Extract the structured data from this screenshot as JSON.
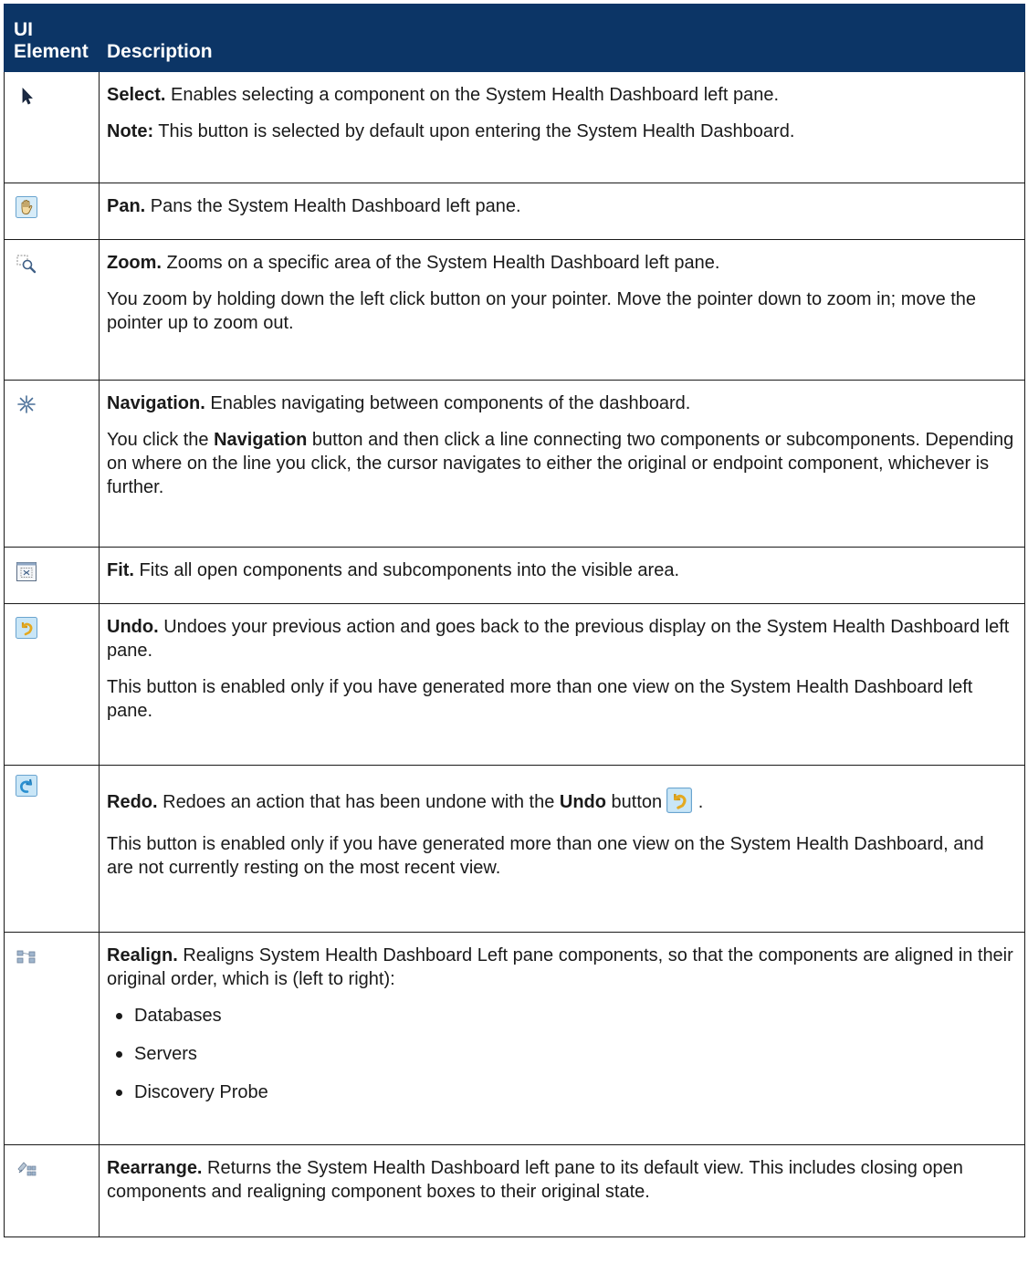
{
  "table": {
    "header": {
      "col1_line1": "UI",
      "col1_line2": "Element",
      "col2": "Description"
    },
    "rows": [
      {
        "icon": "select-arrow-icon",
        "term": "Select.",
        "text": " Enables selecting a component on the System Health Dashboard left pane.",
        "note_term": "Note:",
        "note_text": " This button is selected by default upon entering the System Health Dashboard."
      },
      {
        "icon": "pan-hand-icon",
        "term": "Pan.",
        "text": " Pans the System Health Dashboard left pane."
      },
      {
        "icon": "zoom-magnifier-icon",
        "term": "Zoom.",
        "text": " Zooms on a specific area of the System Health Dashboard left pane.",
        "para2": "You zoom by holding down the left click button on your pointer. Move the pointer down to zoom in; move the pointer up to zoom out."
      },
      {
        "icon": "navigation-star-icon",
        "term": "Navigation.",
        "text": " Enables navigating between components of the dashboard.",
        "para2_pre": "You click the ",
        "para2_term": "Navigation",
        "para2_post": " button and then click a line connecting two components or subcomponents. Depending on where on the line you click, the cursor navigates to either the original or endpoint component, whichever is further."
      },
      {
        "icon": "fit-icon",
        "term": "Fit.",
        "text": " Fits all open components and subcomponents into the visible area."
      },
      {
        "icon": "undo-icon",
        "term": "Undo.",
        "text": " Undoes your previous action and goes back to the previous display on the System Health Dashboard left pane.",
        "para2": "This button is enabled only if you have generated more than one view on the System Health Dashboard left pane."
      },
      {
        "icon": "redo-icon",
        "term": "Redo.",
        "text": " Redoes an action that has been undone with the ",
        "text_term": "Undo",
        "text_post": " button",
        "text_end": " .",
        "para2": "This button is enabled only if you have generated more than one view on the System Health Dashboard, and are not currently resting on the most recent view."
      },
      {
        "icon": "realign-icon",
        "term": "Realign.",
        "text": " Realigns System Health Dashboard Left pane components, so that the components are aligned in their original order, which is (left to right):",
        "bullets": [
          "Databases",
          "Servers",
          "Discovery Probe"
        ]
      },
      {
        "icon": "rearrange-icon",
        "term": "Rearrange.",
        "text": " Returns the System Health Dashboard left pane to its default view. This includes closing open components and realigning component boxes to their original state."
      }
    ]
  }
}
